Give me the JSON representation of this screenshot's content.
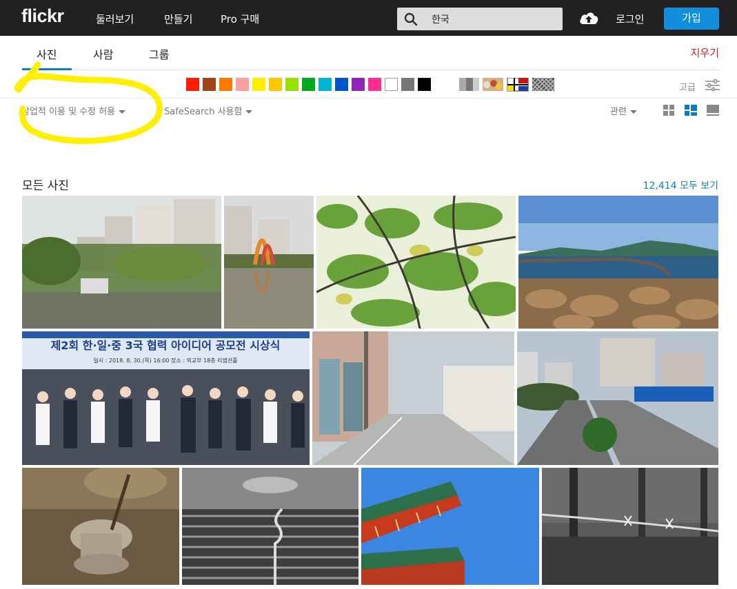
{
  "header": {
    "logo": "flickr",
    "nav": [
      "둘러보기",
      "만들기",
      "Pro 구매"
    ],
    "search_value": "한국",
    "login": "로그인",
    "join": "가입"
  },
  "tabs": [
    {
      "label": "사진",
      "active": true
    },
    {
      "label": "사람",
      "active": false
    },
    {
      "label": "그룹",
      "active": false
    }
  ],
  "clear_label": "지우기",
  "colors": [
    "#ff1a00",
    "#a0441a",
    "#ff7b00",
    "#ff9e9e",
    "#ffee00",
    "#ffc500",
    "#99e000",
    "#00a81e",
    "#00b4d4",
    "#0055cc",
    "#8e24b8",
    "#ff2c95",
    "#ffffff",
    "#777777",
    "#000000"
  ],
  "advanced_label": "고급",
  "filters": {
    "license": "상업적 이용 및 수정 허용",
    "safesearch": "SafeSearch 사용함",
    "sort": "관련"
  },
  "results": {
    "title": "모든 사진",
    "view_all": "12,414 모두 보기"
  },
  "icons": {
    "search": "search-icon",
    "upload": "cloud-upload-icon",
    "advanced": "sliders-icon",
    "view_small": "grid-small-icon",
    "view_justified": "grid-justified-icon",
    "view_large": "grid-large-icon"
  },
  "accent_color": "#0c7dc2",
  "join_color": "#128fdc"
}
